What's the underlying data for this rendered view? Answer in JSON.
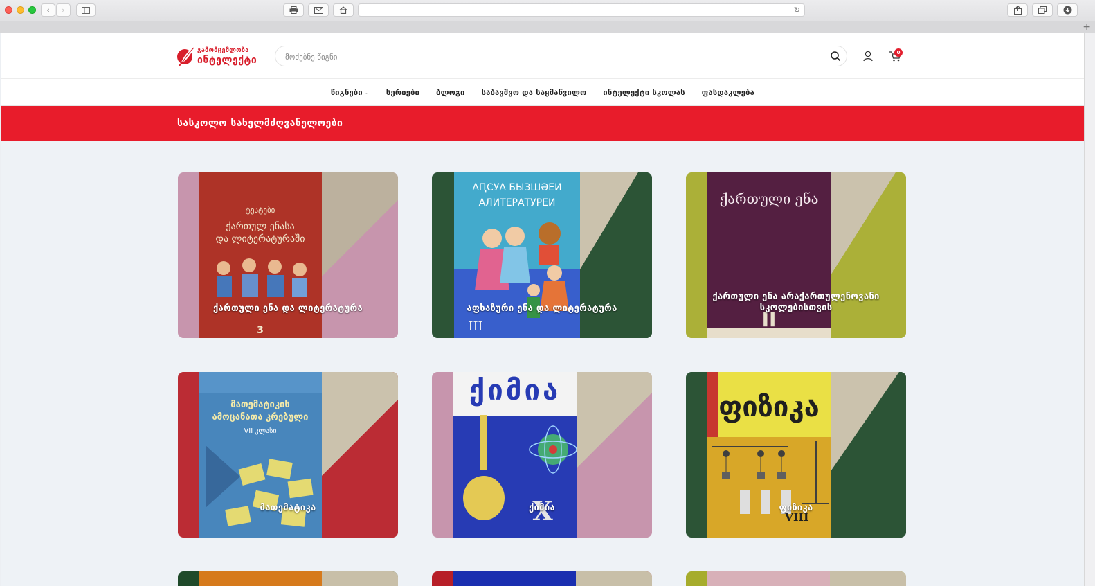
{
  "browser": {
    "address_value": "",
    "buttons": [
      "back",
      "forward",
      "sidebar",
      "print",
      "mail",
      "home",
      "reload",
      "share",
      "tabs",
      "download",
      "new-tab"
    ]
  },
  "site": {
    "logo_top": "გამომცემლობა",
    "logo_bottom": "ინტელექტი",
    "brand_color": "#e81c2b"
  },
  "search": {
    "placeholder": "მოძებნე წიგნი",
    "value": ""
  },
  "cart": {
    "count": "0"
  },
  "nav": {
    "items": [
      {
        "label": "წიგნები",
        "has_dropdown": true
      },
      {
        "label": "სერიები"
      },
      {
        "label": "ბლოგი"
      },
      {
        "label": "საბავშვო და საყმაწვილო"
      },
      {
        "label": "ინტელექტი სკოლას"
      },
      {
        "label": "ფასდაკლება"
      }
    ]
  },
  "banner": {
    "title": "სასკოლო სახელმძღვანელოები"
  },
  "categories": [
    {
      "label": "ქართული ენა და ლიტერატურა",
      "cover_lines": [
        "ტესტები",
        "ქართულ ენასა",
        "და ლიტერატურაში"
      ],
      "cover_grade": "3",
      "cover_color": "#a9271a",
      "side_color": "#c48fa8",
      "tri_color": "#b8ad98"
    },
    {
      "label": "აფხაზური ენა და ლიტერატურა",
      "cover_lines": [
        "АԤСУА БЫЗШӘЕИ",
        "АЛИТЕРАТУРЕИ"
      ],
      "cover_grade": "III",
      "cover_color": "#38a5c9",
      "side_color": "#1f4a2a",
      "tri_color": "#c8bfa8"
    },
    {
      "label": "ქართული ენა არაქართულენოვანი სკოლებისთვის",
      "cover_lines": [
        "ქართული ენა"
      ],
      "cover_grade": "II",
      "cover_color": "#4a1236",
      "side_color": "#a6ac2c",
      "tri_color": "#c8bfa8"
    },
    {
      "label": "მათემატიკა",
      "cover_lines": [
        "მათემატიკის",
        "ამოცანათა კრებული",
        "VII კლასი"
      ],
      "cover_grade": "",
      "cover_color": "#3d7fb8",
      "side_color": "#b71f28",
      "tri_color": "#c8bfa8"
    },
    {
      "label": "ქიმია",
      "cover_lines": [
        "ქიმია"
      ],
      "cover_grade": "X",
      "cover_color": "#1a2fb0",
      "side_color": "#c48fa8",
      "tri_color": "#c8bfa8"
    },
    {
      "label": "ფიზიკა",
      "cover_lines": [
        "ფიზიკა"
      ],
      "cover_grade": "VIII",
      "cover_color": "#d6a21b",
      "side_color": "#1f4a2a",
      "tri_color": "#c8bfa8"
    }
  ]
}
